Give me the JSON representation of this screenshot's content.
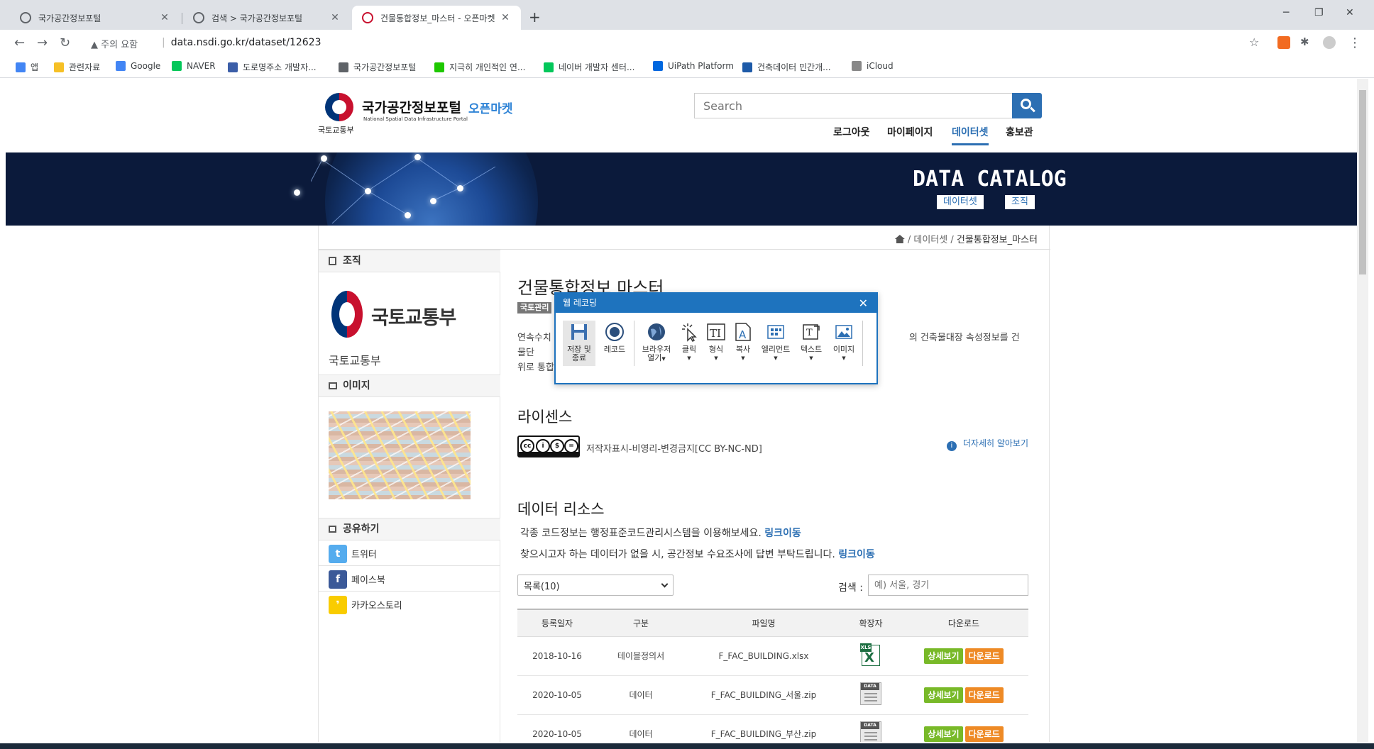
{
  "browser": {
    "tabs": [
      {
        "title": "국가공간정보포털"
      },
      {
        "title": "검색 > 국가공간정보포털"
      },
      {
        "title": "건물통합정보_마스터 - 오픈마켓"
      }
    ],
    "new_tab": "+",
    "window_controls": {
      "minimize": "─",
      "restore": "❐",
      "close": "✕"
    },
    "security_label": "주의 요함",
    "url": "data.nsdi.go.kr/dataset/12623",
    "bookmarks": [
      {
        "label": "앱",
        "color": "#4285f4"
      },
      {
        "label": "관련자료",
        "color": "#f6c026"
      },
      {
        "label": "Google",
        "color": "#4285f4"
      },
      {
        "label": "NAVER",
        "color": "#03c75a"
      },
      {
        "label": "도로명주소 개발자...",
        "color": "#3b5ea8"
      },
      {
        "label": "국가공간정보포털",
        "color": "#5f6368"
      },
      {
        "label": "지극히 개인적인 연...",
        "color": "#1ec800"
      },
      {
        "label": "네이버 개발자 센터...",
        "color": "#03c75a"
      },
      {
        "label": "UiPath Platform",
        "color": "#0067df"
      },
      {
        "label": "건축데이터 민간개...",
        "color": "#1d5aa8"
      },
      {
        "label": "iCloud",
        "color": "#888888"
      }
    ]
  },
  "site": {
    "ministry": "국토교통부",
    "portal_name": "국가공간정보포털",
    "portal_sub": "National Spatial Data Infrastructure Portal",
    "market": "오픈마켓",
    "search_placeholder": "Search",
    "nav": [
      {
        "label": "로그아웃",
        "active": false
      },
      {
        "label": "마이페이지",
        "active": false
      },
      {
        "label": "데이터셋",
        "active": true
      },
      {
        "label": "홍보관",
        "active": false
      }
    ],
    "banner": {
      "title": "DATA CATALOG",
      "buttons": [
        "데이터셋",
        "조직"
      ]
    }
  },
  "breadcrumb": {
    "items": [
      "데이터셋"
    ],
    "current": "건물통합정보_마스터"
  },
  "sidebar": {
    "org_header": "조직",
    "org_logo_text": "국토교통부",
    "org_name": "국토교통부",
    "image_header": "이미지",
    "share_header": "공유하기",
    "share": [
      {
        "label": "트위터",
        "color": "#55acee",
        "glyph": "t"
      },
      {
        "label": "페이스북",
        "color": "#3b5998",
        "glyph": "f"
      },
      {
        "label": "카카오스토리",
        "color": "#f9cc00",
        "glyph": "❜"
      }
    ]
  },
  "dataset": {
    "title": "건물통합정보 마스터",
    "tag": "국토관리",
    "desc_line1_left": "연속수치",
    "desc_line1_right": "의 건축물대장 속성정보를 건물단",
    "desc_line2_left": "위로 통합",
    "license_header": "라이센스",
    "license_text": "저작자표시-비영리-변경금지[CC BY-NC-ND]",
    "license_more": "더자세히 알아보기",
    "resources_header": "데이터 리소스",
    "note1_text": "각종 코드정보는 행정표준코드관리시스템을 이용해보세요.",
    "note1_link": "링크이동",
    "note2_text": "찾으시고자 하는 데이터가 없을 시, 공간정보 수요조사에 답변 부탁드립니다.",
    "note2_link": "링크이동",
    "page_size": "목록(10)",
    "table_search_label": "검색 :",
    "table_search_placeholder": "예) 서울, 경기",
    "columns": [
      "등록일자",
      "구분",
      "파일명",
      "확장자",
      "다운로드"
    ],
    "rows": [
      {
        "date": "2018-10-16",
        "type": "테이블정의서",
        "file": "F_FAC_BUILDING.xlsx",
        "ext": "xls"
      },
      {
        "date": "2020-10-05",
        "type": "데이터",
        "file": "F_FAC_BUILDING_서울.zip",
        "ext": "data"
      },
      {
        "date": "2020-10-05",
        "type": "데이터",
        "file": "F_FAC_BUILDING_부산.zip",
        "ext": "data"
      }
    ],
    "detail_label": "상세보기",
    "download_label": "다운로드"
  },
  "recorder": {
    "title": "웹 레코딩",
    "tools": [
      {
        "label1": "저장 및",
        "label2": "종료",
        "icon": "save-icon"
      },
      {
        "label1": "레코드",
        "label2": "",
        "icon": "record-icon"
      },
      {
        "label1": "브라우저",
        "label2": "열기",
        "icon": "browser-globe-icon"
      },
      {
        "label1": "클릭",
        "label2": "",
        "icon": "click-icon"
      },
      {
        "label1": "형식",
        "label2": "",
        "icon": "type-text-icon"
      },
      {
        "label1": "복사",
        "label2": "",
        "icon": "copy-icon"
      },
      {
        "label1": "엘리먼트",
        "label2": "",
        "icon": "element-icon"
      },
      {
        "label1": "텍스트",
        "label2": "",
        "icon": "text-icon"
      },
      {
        "label1": "이미지",
        "label2": "",
        "icon": "image-icon"
      }
    ]
  }
}
